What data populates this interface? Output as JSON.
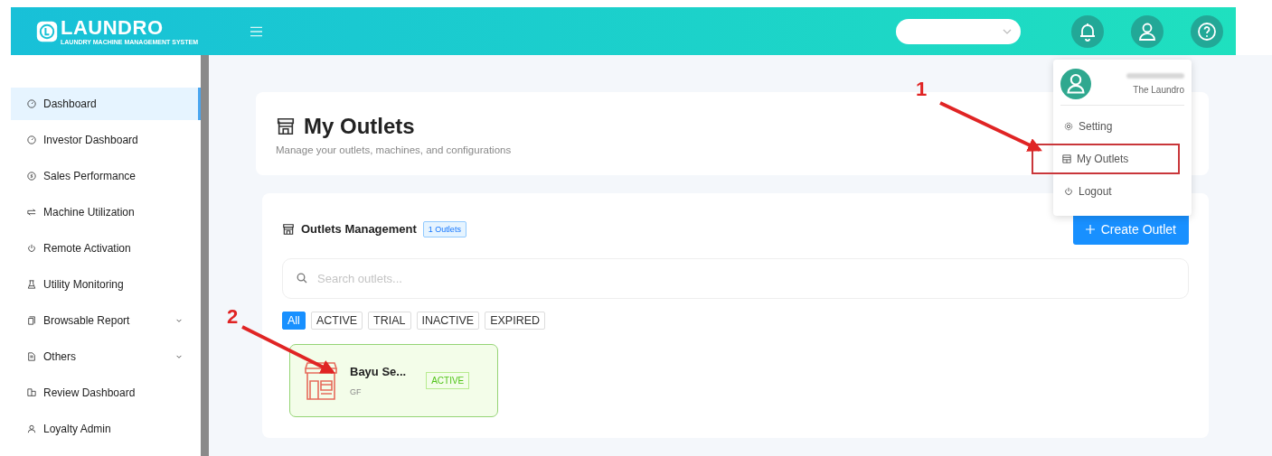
{
  "header": {
    "logo": {
      "name": "LAUNDRO",
      "tagline": "LAUNDRY MACHINE MANAGEMENT SYSTEM"
    }
  },
  "sidebar": {
    "items": [
      {
        "label": "Dashboard",
        "selected": true,
        "expandable": false
      },
      {
        "label": "Investor Dashboard",
        "selected": false,
        "expandable": false
      },
      {
        "label": "Sales Performance",
        "selected": false,
        "expandable": false
      },
      {
        "label": "Machine Utilization",
        "selected": false,
        "expandable": false
      },
      {
        "label": "Remote Activation",
        "selected": false,
        "expandable": false
      },
      {
        "label": "Utility Monitoring",
        "selected": false,
        "expandable": false
      },
      {
        "label": "Browsable Report",
        "selected": false,
        "expandable": true
      },
      {
        "label": "Others",
        "selected": false,
        "expandable": true
      },
      {
        "label": "Review Dashboard",
        "selected": false,
        "expandable": false
      },
      {
        "label": "Loyalty Admin",
        "selected": false,
        "expandable": false
      }
    ]
  },
  "user_menu": {
    "company": "The Laundro",
    "items": [
      {
        "label": "Setting",
        "highlighted": false
      },
      {
        "label": "My Outlets",
        "highlighted": true
      },
      {
        "label": "Logout",
        "highlighted": false
      }
    ]
  },
  "page_header": {
    "title": "My Outlets",
    "subtitle": "Manage your outlets, machines, and configurations"
  },
  "outlets": {
    "title": "Outlets Management",
    "count": "1 Outlets",
    "create_button": "Create Outlet",
    "search": {
      "placeholder": "Search outlets..."
    },
    "filters": [
      {
        "label": "All",
        "selected": true
      },
      {
        "label": "ACTIVE",
        "selected": false
      },
      {
        "label": "TRIAL",
        "selected": false
      },
      {
        "label": "INACTIVE",
        "selected": false
      },
      {
        "label": "EXPIRED",
        "selected": false
      }
    ],
    "cards": [
      {
        "name": "Bayu Se...",
        "floor": "GF",
        "status": "ACTIVE"
      }
    ]
  },
  "annotations": [
    {
      "label": "1"
    },
    {
      "label": "2"
    }
  ]
}
